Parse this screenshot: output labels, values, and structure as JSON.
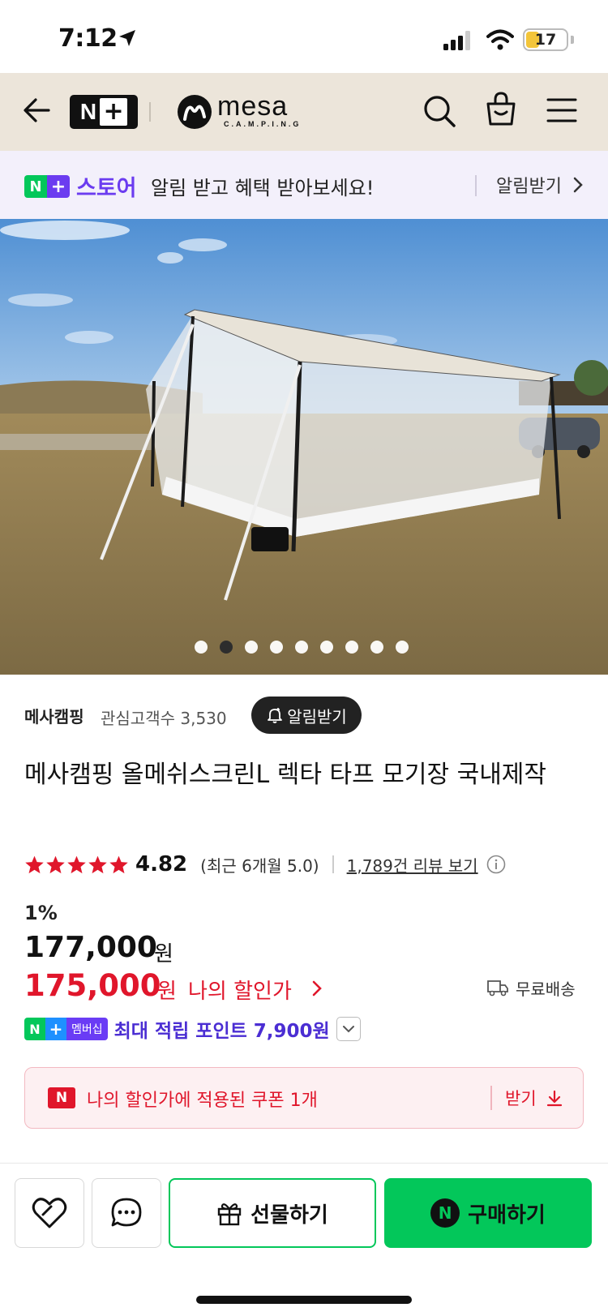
{
  "status_bar": {
    "time": "7:12",
    "battery": "17"
  },
  "header": {
    "brand_word": "mesa",
    "brand_sub": "C.A.M.P.I.N.G"
  },
  "promo": {
    "store_label": "스토어",
    "text": "알림 받고 혜택 받아보세요!",
    "cta": "알림받기"
  },
  "gallery": {
    "slide_count": 9,
    "active_index": 1
  },
  "seller": {
    "name": "메사캠핑",
    "fans": "관심고객수 3,530",
    "follow_label": "알림받기"
  },
  "product": {
    "title": "메사캠핑 올메쉬스크린L 렉타 타프 모기장 국내제작",
    "rating": {
      "stars": 5,
      "score": "4.82",
      "recent": "(최근 6개월 5.0)",
      "reviews_link": "1,789건 리뷰 보기"
    },
    "discount_rate": "1%",
    "original_price": "177,000",
    "sale_price": "175,000",
    "won": "원",
    "my_price_label": "나의 할인가",
    "free_shipping": "무료배송",
    "membership_badge": "멤버십",
    "points_text": "최대 적립 포인트 7,900원"
  },
  "coupon": {
    "badge": "N",
    "text": "나의 할인가에 적용된 쿠폰 1개",
    "get_label": "받기"
  },
  "bottom": {
    "gift_label": "선물하기",
    "buy_label": "구매하기",
    "buy_badge": "N"
  },
  "colors": {
    "naver_green": "#03c75a",
    "sale_red": "#e0162b",
    "plus_purple": "#6b3cf0",
    "header_bg": "#ece5da"
  }
}
